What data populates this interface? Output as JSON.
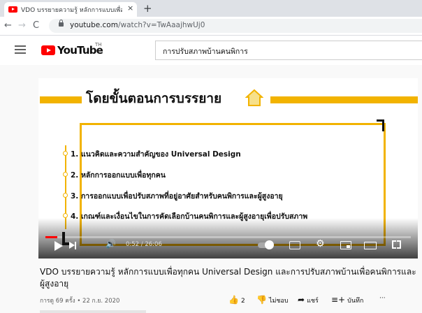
{
  "browser": {
    "tab_title": "VDO บรรยายความรู้ หลักการแบบเพื่อ",
    "tab_close": "×",
    "new_tab": "+",
    "nav": {
      "back": "←",
      "forward": "→",
      "reload": "C"
    },
    "url_host": "youtube.com",
    "url_path": "/watch?v=TwAaajhwUj0",
    "brand_color": "#ff0000"
  },
  "youtube": {
    "logo_text": "YouTube",
    "region": "TH",
    "search_value": "การปรับสภาพบ้านคนพิการ"
  },
  "slide": {
    "heading": "โดยขั้นตอนการบรรยาย",
    "accent_color": "#f2b300",
    "items": [
      {
        "label": "1.  แนวคิดและความสำคัญของ Universal Design"
      },
      {
        "label": "2.  หลักการออกแบบเพื่อทุกคน"
      },
      {
        "label": "3.  การออกแบบเพื่อปรับสภาพที่อยู่อาศัยสำหรับคนพิการและผู้สูงอายุ"
      },
      {
        "label": "4.  เกณฑ์และเงื่อนไขในการคัดเลือกบ้านคนพิการและผู้สูงอายุเพื่อปรับสภาพ"
      }
    ]
  },
  "player": {
    "time": "0:52 / 26:06",
    "progress_fraction": 0.033,
    "icons": [
      "play-icon",
      "next-icon",
      "volume-icon",
      "autoplay-toggle",
      "subtitles-icon",
      "settings-icon",
      "miniplayer-icon",
      "theater-icon",
      "fullscreen-icon"
    ]
  },
  "video": {
    "title": "VDO บรรยายความรู้ หลักการแบบเพื่อทุกคน Universal Design และการปรับสภาพบ้านเพื่อคนพิการและผู้สูงอายุ",
    "meta": "การดู 69 ครั้ง • 22 ก.ย. 2020",
    "actions": {
      "like_count": "2",
      "dislike_label": "ไม่ชอบ",
      "share_label": "แชร์",
      "save_label": "บันทึก",
      "more_label": "···"
    }
  }
}
